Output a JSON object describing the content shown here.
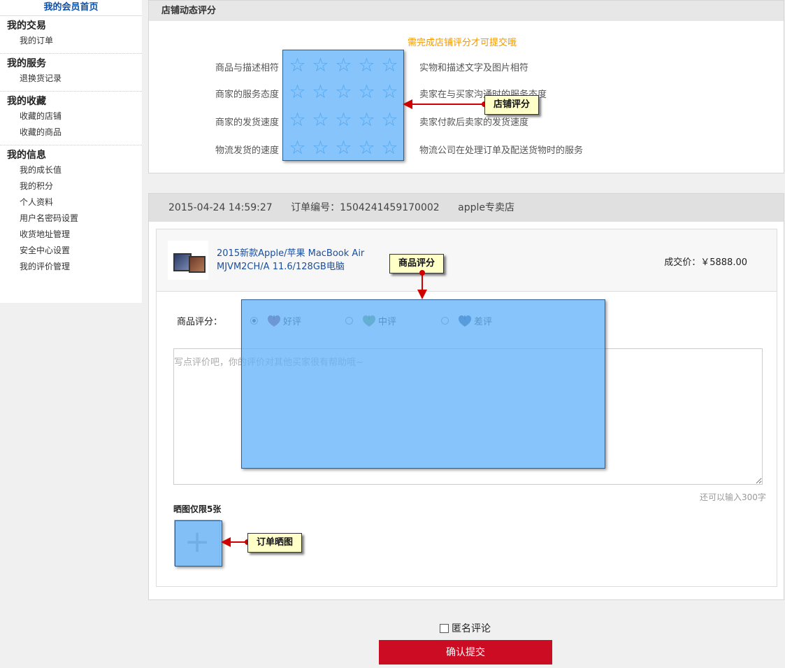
{
  "sidebar": {
    "home": "我的会员首页",
    "groups": [
      {
        "title": "我的交易",
        "items": [
          "我的订单"
        ]
      },
      {
        "title": "我的服务",
        "items": [
          "退换货记录"
        ]
      },
      {
        "title": "我的收藏",
        "items": [
          "收藏的店铺",
          "收藏的商品"
        ]
      },
      {
        "title": "我的信息",
        "items": [
          "我的成长值",
          "我的积分",
          "个人资料",
          "用户名密码设置",
          "收货地址管理",
          "安全中心设置",
          "我的评价管理"
        ]
      }
    ]
  },
  "store_rating": {
    "header": "店铺动态评分",
    "notice": "需完成店铺评分才可提交哦",
    "star_glyph": "☆",
    "rows": [
      {
        "label": "商品与描述相符",
        "desc": "实物和描述文字及图片相符"
      },
      {
        "label": "商家的服务态度",
        "desc": "卖家在与买家沟通时的服务态度"
      },
      {
        "label": "商家的发货速度",
        "desc": "卖家付款后卖家的发货速度"
      },
      {
        "label": "物流发货的速度",
        "desc": "物流公司在处理订单及配送货物时的服务"
      }
    ]
  },
  "order": {
    "datetime": "2015-04-24 14:59:27",
    "order_no": "订单编号：1504241459170002",
    "shop": "apple专卖店",
    "product_name": "2015新款Apple/苹果 MacBook Air MJVM2CH/A 11.6/128GB电脑",
    "price": "成交价：￥5888.00",
    "rating_label": "商品评分：",
    "rating_options": [
      {
        "label": "好评",
        "selected": true,
        "color": "#8b3a52"
      },
      {
        "label": "中评",
        "selected": false,
        "color": "#6b9e4e"
      },
      {
        "label": "差评",
        "selected": false,
        "color": "#2a4a78"
      }
    ],
    "comment_placeholder": "写点评价吧，你的评价对其他买家很有帮助哦~",
    "remaining": "还可以输入300字",
    "photo_label": "晒图仅限5张",
    "upload_glyph": "+"
  },
  "bottom": {
    "anonymous": "匿名评论",
    "submit": "确认提交"
  },
  "annotations": {
    "store_rating": "店铺评分",
    "product_rating": "商品评分",
    "order_photo": "订单晒图"
  },
  "colors": {
    "accent_red": "#cc0c22",
    "link_blue": "#1a4fa0",
    "notice_orange": "#f39800"
  }
}
